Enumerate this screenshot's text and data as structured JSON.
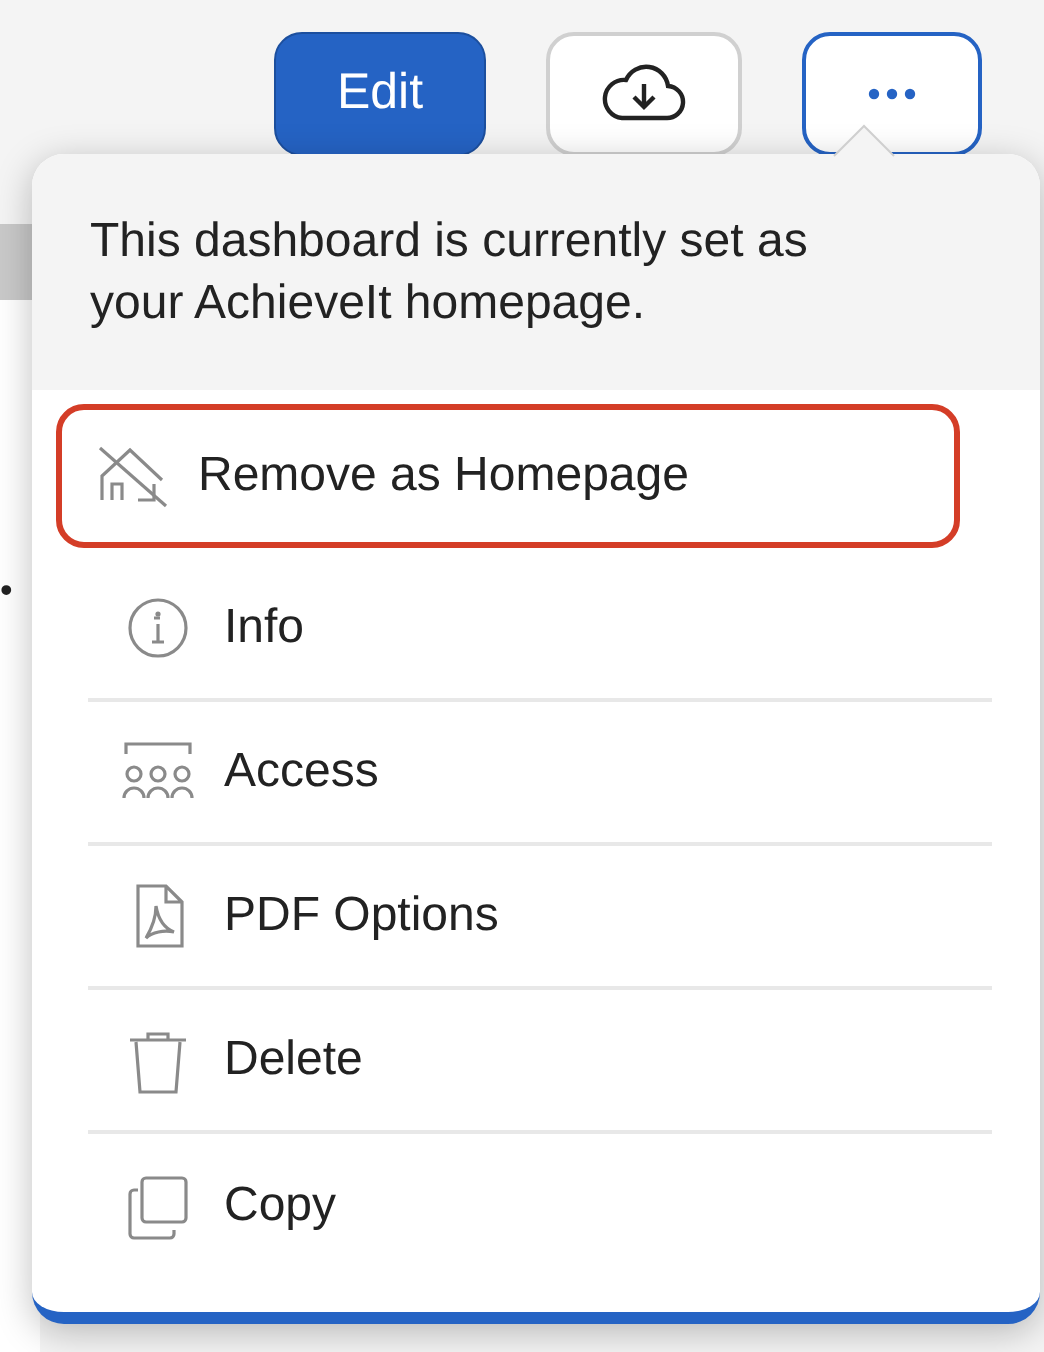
{
  "toolbar": {
    "edit_button": "Edit"
  },
  "background_marker": "•",
  "menu": {
    "message": "This dashboard is currently set as your AchieveIt homepage.",
    "items": [
      {
        "kind": "home-off",
        "label": "Remove as Homepage",
        "highlighted": true
      },
      {
        "kind": "info",
        "label": "Info",
        "highlighted": false
      },
      {
        "kind": "access",
        "label": "Access",
        "highlighted": false
      },
      {
        "kind": "pdf",
        "label": "PDF Options",
        "highlighted": false
      },
      {
        "kind": "delete",
        "label": "Delete",
        "highlighted": false
      },
      {
        "kind": "copy",
        "label": "Copy",
        "highlighted": false
      }
    ]
  }
}
